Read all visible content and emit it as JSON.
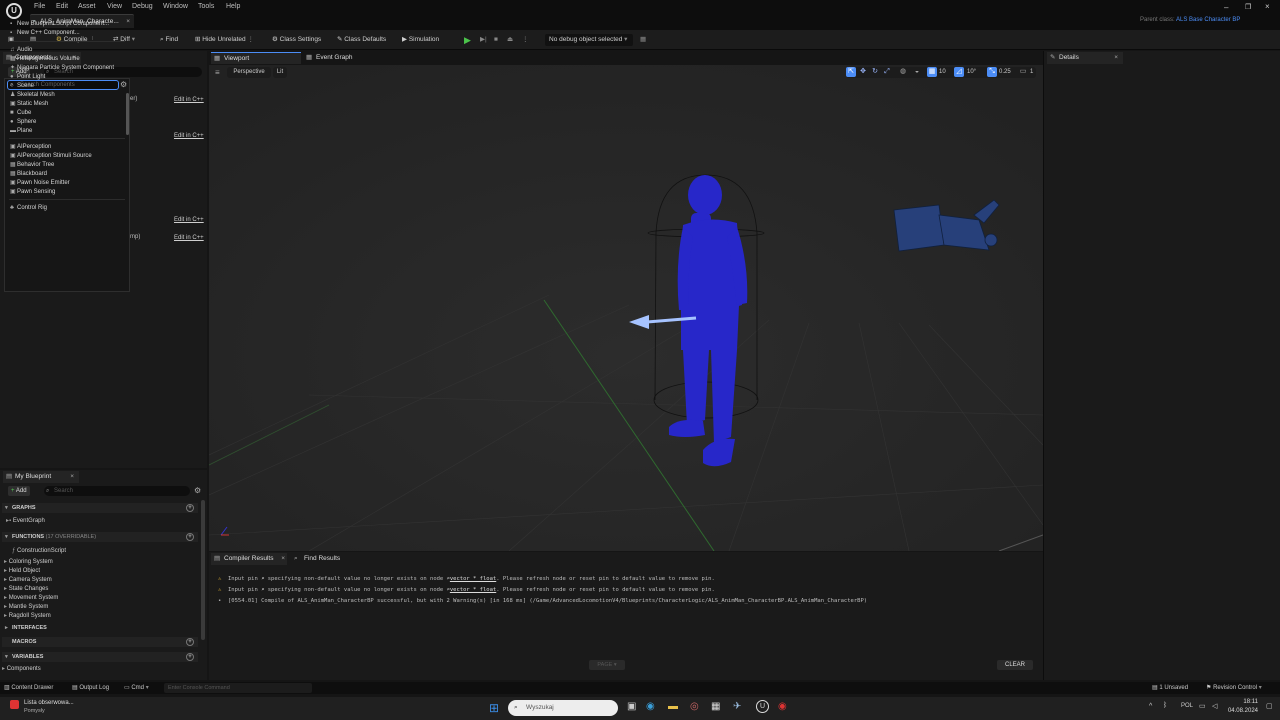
{
  "menu": [
    "File",
    "Edit",
    "Asset",
    "View",
    "Debug",
    "Window",
    "Tools",
    "Help"
  ],
  "doc_tab": "ALS_AnimMan_Characte...",
  "parent_class_label": "Parent class:",
  "parent_class_value": "ALS Base Character BP",
  "toolbar": {
    "compile": "Compile",
    "diff": "Diff",
    "find": "Find",
    "hide_unrelated": "Hide Unrelated",
    "class_settings": "Class Settings",
    "class_defaults": "Class Defaults",
    "simulation": "Simulation",
    "debug_select": "No debug object selected"
  },
  "components": {
    "tab": "Components",
    "add": "Add",
    "search_placeholder": "Search",
    "dropdown_search_placeholder": "Search Components",
    "behind_text_1": "er)",
    "behind_text_2": "mp)",
    "edit_in_cpp": "Edit in C++",
    "items_top": [
      "New Blueprint Script Component...",
      "New C++ Component..."
    ],
    "items_common": [
      "Audio",
      "Heterogeneous Volume",
      "Niagara Particle System Component",
      "Point Light",
      "Scene",
      "Skeletal Mesh",
      "Static Mesh",
      "Cube",
      "Sphere",
      "Plane"
    ],
    "items_ai": [
      "AIPerception",
      "AIPerception Stimuli Source",
      "Behavior Tree",
      "Blackboard",
      "Pawn Noise Emitter",
      "Pawn Sensing"
    ],
    "items_bottom": [
      "Control Rig"
    ]
  },
  "viewport": {
    "tab": "Viewport",
    "event_graph_tab": "Event Graph",
    "perspective": "Perspective",
    "lit": "Lit",
    "grid_value": "10",
    "angle_value": "10°",
    "scale_value": "0.25",
    "camera_value": "1"
  },
  "details": {
    "tab": "Details"
  },
  "my_blueprint": {
    "tab": "My Blueprint",
    "add": "Add",
    "search_placeholder": "Search",
    "graphs": "GRAPHS",
    "event_graph": "EventGraph",
    "functions": "FUNCTIONS",
    "functions_overridable": "(17 OVERRIDABLE)",
    "construction_script": "ConstructionScript",
    "categories": [
      "Coloring System",
      "Held Object",
      "Camera System",
      "State Changes",
      "Movement System",
      "Mantle System",
      "Ragdoll System"
    ],
    "interfaces": "INTERFACES",
    "macros": "MACROS",
    "variables": "VARIABLES",
    "components": "Components"
  },
  "bottom": {
    "compiler_results": "Compiler Results",
    "find_results": "Find Results",
    "log": [
      {
        "type": "warning",
        "pre": "Input pin",
        "icon_text": "specifying non-default value no longer exists on node",
        "node": "vector * float",
        "post": ". Please refresh node or reset pin to default value to remove pin."
      },
      {
        "type": "warning",
        "pre": "Input pin",
        "icon_text": "specifying non-default value no longer exists on node",
        "node": "vector * float",
        "post": ". Please refresh node or reset pin to default value to remove pin."
      },
      {
        "type": "info",
        "text": "[0554.01] Compile of ALS_AnimMan_CharacterBP successful, but with 2 Warning(s) [in 168 ms] (/Game/AdvancedLocomotionV4/Blueprints/CharacterLogic/ALS_AnimMan_CharacterBP.ALS_AnimMan_CharacterBP)"
      }
    ],
    "page": "PAGE",
    "clear": "CLEAR"
  },
  "statusbar": {
    "content_drawer": "Content Drawer",
    "output_log": "Output Log",
    "cmd": "Cmd",
    "console_placeholder": "Enter Console Command",
    "unsaved": "1 Unsaved",
    "revision_control": "Revision Control"
  },
  "taskbar": {
    "widget_title": "Lista obserwowa...",
    "widget_sub": "Pomysły",
    "search_placeholder": "Wyszukaj",
    "lang": "POL",
    "time": "18:11",
    "date": "04.08.2024"
  },
  "colors": {
    "accent": "#4c8df6",
    "character": "#2727c9",
    "warning": "#e5b637",
    "play": "#4bc44b"
  }
}
